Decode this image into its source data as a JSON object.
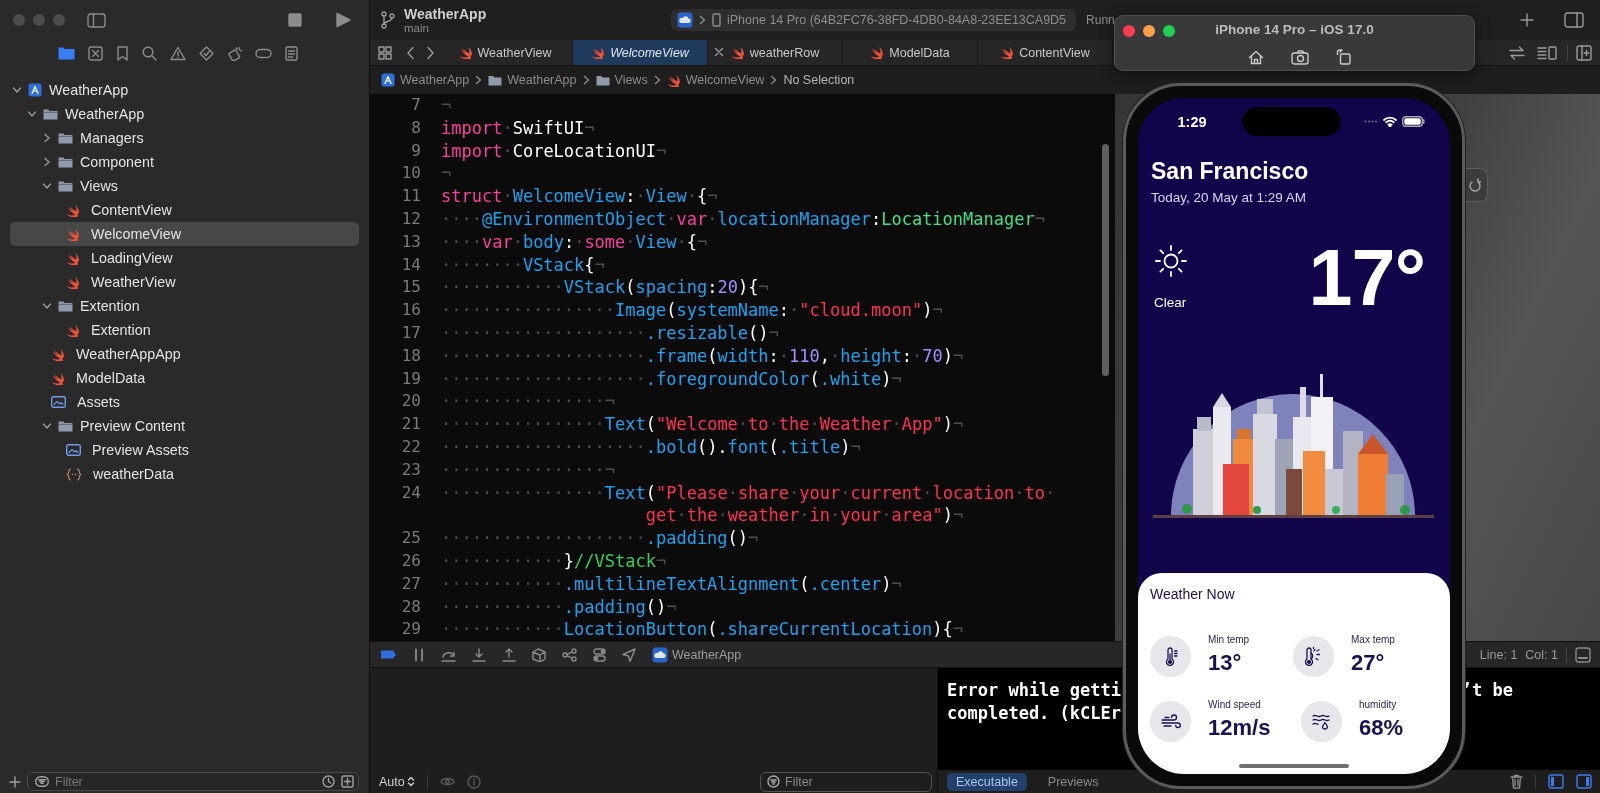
{
  "toolbar": {
    "project": "WeatherApp",
    "branch": "main",
    "destination": "iPhone 14 Pro (64B2FC76-38FD-4DB0-84A8-23EE13CA9D5",
    "status": "Runn"
  },
  "tabs": [
    {
      "label": "WeatherView",
      "selected": false,
      "closable": false
    },
    {
      "label": "WelcomeView",
      "selected": true,
      "closable": false
    },
    {
      "label": "weatherRow",
      "selected": false,
      "closable": true
    },
    {
      "label": "ModelData",
      "selected": false,
      "closable": false
    },
    {
      "label": "ContentView",
      "selected": false,
      "closable": false
    }
  ],
  "breadcrumb": [
    {
      "label": "WeatherApp",
      "kind": "project"
    },
    {
      "label": "WeatherApp",
      "kind": "folder"
    },
    {
      "label": "Views",
      "kind": "folder"
    },
    {
      "label": "WelcomeView",
      "kind": "swift"
    },
    {
      "label": "No Selection",
      "kind": "none"
    }
  ],
  "navigator": {
    "tree": [
      {
        "label": "WeatherApp",
        "kind": "project",
        "expanded": true,
        "selected": false,
        "children": [
          {
            "label": "WeatherApp",
            "kind": "folder",
            "expanded": true,
            "selected": false,
            "children": [
              {
                "label": "Managers",
                "kind": "folder",
                "expanded": false,
                "selected": false
              },
              {
                "label": "Component",
                "kind": "folder",
                "expanded": false,
                "selected": false
              },
              {
                "label": "Views",
                "kind": "folder",
                "expanded": true,
                "selected": false,
                "children": [
                  {
                    "label": "ContentView",
                    "kind": "swift",
                    "selected": false
                  },
                  {
                    "label": "WelcomeView",
                    "kind": "swift",
                    "selected": true
                  },
                  {
                    "label": "LoadingView",
                    "kind": "swift",
                    "selected": false
                  },
                  {
                    "label": "WeatherView",
                    "kind": "swift",
                    "selected": false
                  }
                ]
              },
              {
                "label": "Extention",
                "kind": "folder",
                "expanded": true,
                "selected": false,
                "children": [
                  {
                    "label": "Extention",
                    "kind": "swift",
                    "selected": false
                  }
                ]
              },
              {
                "label": "WeatherAppApp",
                "kind": "swift",
                "selected": false
              },
              {
                "label": "ModelData",
                "kind": "swift",
                "selected": false
              },
              {
                "label": "Assets",
                "kind": "assets",
                "selected": false
              },
              {
                "label": "Preview Content",
                "kind": "folder",
                "expanded": true,
                "selected": false,
                "children": [
                  {
                    "label": "Preview Assets",
                    "kind": "assets",
                    "selected": false
                  },
                  {
                    "label": "weatherData",
                    "kind": "json",
                    "selected": false
                  }
                ]
              }
            ]
          }
        ]
      }
    ],
    "filter_placeholder": "Filter"
  },
  "editor": {
    "lines": [
      {
        "n": "7",
        "tokens": [
          {
            "kind": "plain",
            "text": "¬"
          }
        ]
      },
      {
        "n": "8",
        "tokens": [
          {
            "kind": "keyword",
            "text": "import"
          },
          {
            "kind": "plain",
            "text": "·SwiftUI¬"
          }
        ]
      },
      {
        "n": "9",
        "tokens": [
          {
            "kind": "keyword",
            "text": "import"
          },
          {
            "kind": "plain",
            "text": "·CoreLocationUI¬"
          }
        ]
      },
      {
        "n": "10",
        "tokens": [
          {
            "kind": "plain",
            "text": "¬"
          }
        ]
      },
      {
        "n": "11",
        "tokens": [
          {
            "kind": "keyword",
            "text": "struct"
          },
          {
            "kind": "plain",
            "text": "·"
          },
          {
            "kind": "symbol",
            "text": "WelcomeView"
          },
          {
            "kind": "plain",
            "text": ":·"
          },
          {
            "kind": "symbol",
            "text": "View"
          },
          {
            "kind": "plain",
            "text": "·{¬"
          }
        ]
      },
      {
        "n": "12",
        "tokens": [
          {
            "kind": "plain",
            "text": "····"
          },
          {
            "kind": "symbol",
            "text": "@EnvironmentObject"
          },
          {
            "kind": "plain",
            "text": "·"
          },
          {
            "kind": "keyword",
            "text": "var"
          },
          {
            "kind": "plain",
            "text": "·"
          },
          {
            "kind": "symbol",
            "text": "locationManager"
          },
          {
            "kind": "plain",
            "text": ":"
          },
          {
            "kind": "type",
            "text": "LocationManager"
          },
          {
            "kind": "plain",
            "text": "¬"
          }
        ]
      },
      {
        "n": "13",
        "tokens": [
          {
            "kind": "plain",
            "text": "····"
          },
          {
            "kind": "keyword",
            "text": "var"
          },
          {
            "kind": "plain",
            "text": "·"
          },
          {
            "kind": "symbol",
            "text": "body"
          },
          {
            "kind": "plain",
            "text": ":·"
          },
          {
            "kind": "keyword",
            "text": "some"
          },
          {
            "kind": "plain",
            "text": "·"
          },
          {
            "kind": "symbol",
            "text": "View"
          },
          {
            "kind": "plain",
            "text": "·{¬"
          }
        ]
      },
      {
        "n": "14",
        "tokens": [
          {
            "kind": "plain",
            "text": "········"
          },
          {
            "kind": "symbol",
            "text": "VStack"
          },
          {
            "kind": "plain",
            "text": "{¬"
          }
        ]
      },
      {
        "n": "15",
        "tokens": [
          {
            "kind": "plain",
            "text": "············"
          },
          {
            "kind": "symbol",
            "text": "VStack"
          },
          {
            "kind": "plain",
            "text": "("
          },
          {
            "kind": "symbol",
            "text": "spacing"
          },
          {
            "kind": "plain",
            "text": ":"
          },
          {
            "kind": "number",
            "text": "20"
          },
          {
            "kind": "plain",
            "text": "){¬"
          }
        ]
      },
      {
        "n": "16",
        "tokens": [
          {
            "kind": "plain",
            "text": "·················"
          },
          {
            "kind": "symbol",
            "text": "Image"
          },
          {
            "kind": "plain",
            "text": "("
          },
          {
            "kind": "symbol",
            "text": "systemName"
          },
          {
            "kind": "plain",
            "text": ":·"
          },
          {
            "kind": "string",
            "text": "\"cloud.moon\""
          },
          {
            "kind": "plain",
            "text": ")¬"
          }
        ]
      },
      {
        "n": "17",
        "tokens": [
          {
            "kind": "plain",
            "text": "····················"
          },
          {
            "kind": "symbol",
            "text": ".resizable"
          },
          {
            "kind": "plain",
            "text": "()¬"
          }
        ]
      },
      {
        "n": "18",
        "tokens": [
          {
            "kind": "plain",
            "text": "····················"
          },
          {
            "kind": "symbol",
            "text": ".frame"
          },
          {
            "kind": "plain",
            "text": "("
          },
          {
            "kind": "symbol",
            "text": "width"
          },
          {
            "kind": "plain",
            "text": ":·"
          },
          {
            "kind": "number",
            "text": "110"
          },
          {
            "kind": "plain",
            "text": ",·"
          },
          {
            "kind": "symbol",
            "text": "height"
          },
          {
            "kind": "plain",
            "text": ":·"
          },
          {
            "kind": "number",
            "text": "70"
          },
          {
            "kind": "plain",
            "text": ")¬"
          }
        ]
      },
      {
        "n": "19",
        "tokens": [
          {
            "kind": "plain",
            "text": "····················"
          },
          {
            "kind": "symbol",
            "text": ".foregroundColor"
          },
          {
            "kind": "plain",
            "text": "("
          },
          {
            "kind": "symbol",
            "text": ".white"
          },
          {
            "kind": "plain",
            "text": ")¬"
          }
        ]
      },
      {
        "n": "20",
        "tokens": [
          {
            "kind": "plain",
            "text": "················¬"
          }
        ]
      },
      {
        "n": "21",
        "tokens": [
          {
            "kind": "plain",
            "text": "················"
          },
          {
            "kind": "symbol",
            "text": "Text"
          },
          {
            "kind": "plain",
            "text": "("
          },
          {
            "kind": "string",
            "text": "\"Welcome·to·the·Weather·App\""
          },
          {
            "kind": "plain",
            "text": ")¬"
          }
        ]
      },
      {
        "n": "22",
        "tokens": [
          {
            "kind": "plain",
            "text": "····················"
          },
          {
            "kind": "symbol",
            "text": ".bold"
          },
          {
            "kind": "plain",
            "text": "()."
          },
          {
            "kind": "symbol",
            "text": "font"
          },
          {
            "kind": "plain",
            "text": "("
          },
          {
            "kind": "symbol",
            "text": ".title"
          },
          {
            "kind": "plain",
            "text": ")¬"
          }
        ]
      },
      {
        "n": "23",
        "tokens": [
          {
            "kind": "plain",
            "text": "················¬"
          }
        ]
      },
      {
        "n": "24",
        "tokens": [
          {
            "kind": "plain",
            "text": "················"
          },
          {
            "kind": "symbol",
            "text": "Text"
          },
          {
            "kind": "plain",
            "text": "("
          },
          {
            "kind": "string",
            "text": "\"Please·share·your·current·location·to·"
          }
        ],
        "wrap": [
          {
            "kind": "string",
            "text": "get·the·weather·in·your·area\""
          },
          {
            "kind": "plain",
            "text": ")¬"
          }
        ]
      },
      {
        "n": "25",
        "tokens": [
          {
            "kind": "plain",
            "text": "····················"
          },
          {
            "kind": "symbol",
            "text": ".padding"
          },
          {
            "kind": "plain",
            "text": "()¬"
          }
        ]
      },
      {
        "n": "26",
        "tokens": [
          {
            "kind": "plain",
            "text": "············}"
          },
          {
            "kind": "comment",
            "text": "//VStack"
          },
          {
            "kind": "plain",
            "text": "¬"
          }
        ]
      },
      {
        "n": "27",
        "tokens": [
          {
            "kind": "plain",
            "text": "············"
          },
          {
            "kind": "symbol",
            "text": ".multilineTextAlignment"
          },
          {
            "kind": "plain",
            "text": "("
          },
          {
            "kind": "symbol",
            "text": ".center"
          },
          {
            "kind": "plain",
            "text": ")¬"
          }
        ]
      },
      {
        "n": "28",
        "tokens": [
          {
            "kind": "plain",
            "text": "············"
          },
          {
            "kind": "symbol",
            "text": ".padding"
          },
          {
            "kind": "plain",
            "text": "()¬"
          }
        ]
      },
      {
        "n": "29",
        "tokens": [
          {
            "kind": "plain",
            "text": "············"
          },
          {
            "kind": "symbol",
            "text": "LocationButton"
          },
          {
            "kind": "plain",
            "text": "("
          },
          {
            "kind": "symbol",
            "text": ".shareCurrentLocation"
          },
          {
            "kind": "plain",
            "text": "){¬"
          }
        ]
      }
    ]
  },
  "debug_bar": {
    "target": "WeatherApp",
    "line": "Line: 1",
    "column": "Col: 1"
  },
  "variables": {
    "mode": "Auto",
    "filter_placeholder": "Filter"
  },
  "console": {
    "lines": [
      "Error while getti",
      "completed. (kCLEr"
    ],
    "line_tail": "’t be",
    "scopes": [
      {
        "label": "Executable",
        "selected": true
      },
      {
        "label": "Previews",
        "selected": false
      }
    ]
  },
  "simulator": {
    "title": "iPhone 14 Pro – iOS 17.0"
  },
  "phone": {
    "time": "1:29",
    "city": "San Francisco",
    "date": "Today, 20 May at 1:29 AM",
    "condition": "Clear",
    "temperature": "17°",
    "card_title": "Weather Now",
    "metrics": [
      {
        "kind": "min_temp",
        "label": "Min temp",
        "value": "13°"
      },
      {
        "kind": "max_temp",
        "label": "Max temp",
        "value": "27°"
      },
      {
        "kind": "wind",
        "label": "Wind speed",
        "value": "12m/s"
      },
      {
        "kind": "humidity",
        "label": "humidity",
        "value": "68%"
      }
    ]
  }
}
